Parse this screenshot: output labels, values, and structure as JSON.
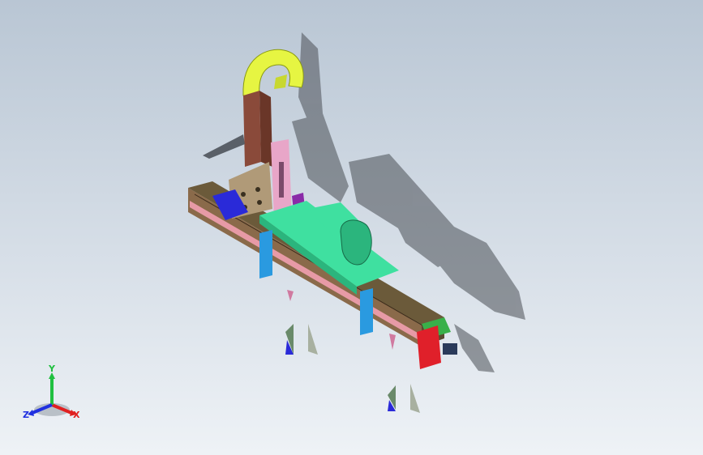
{
  "viewport": {
    "background_top": "#b9c6d4",
    "background_bottom": "#eef2f6"
  },
  "model": {
    "name": "gantry-linear-module-assembly",
    "colors": {
      "hook": "#e6f542",
      "column": "#8a4a3a",
      "mount_plate": "#b09a78",
      "pink_plate": "#e8a6c8",
      "rail_top": "#6b5a3a",
      "rail_side": "#e79aa6",
      "carriage": "#3fe0a0",
      "carriage_dark": "#2bb57d",
      "blue_block": "#2a2ad8",
      "cyan_post": "#2a9ae0",
      "red_motor": "#e0202a",
      "green_block": "#39b04a",
      "purple_block": "#8a2aa8",
      "shadow": "#4a4f55"
    }
  },
  "triad": {
    "x_label": "X",
    "y_label": "Y",
    "z_label": "Z",
    "x_color": "#e02020",
    "y_color": "#20c040",
    "z_color": "#2030e0"
  }
}
